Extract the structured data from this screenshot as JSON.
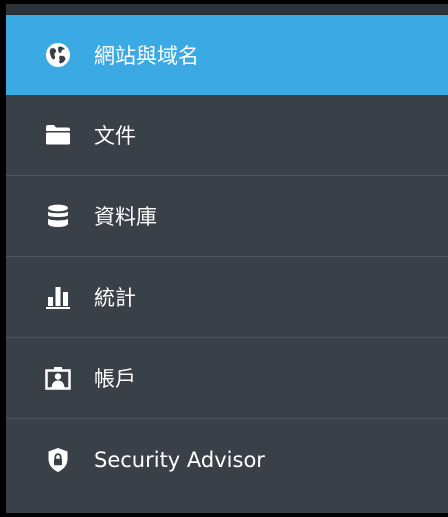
{
  "sidebar": {
    "accent_color": "#3aa9e4",
    "background_color": "#3a4048",
    "items": [
      {
        "label": "網站與域名",
        "icon": "globe-icon",
        "active": true
      },
      {
        "label": "文件",
        "icon": "folder-icon",
        "active": false
      },
      {
        "label": "資料庫",
        "icon": "database-icon",
        "active": false
      },
      {
        "label": "統計",
        "icon": "bar-chart-icon",
        "active": false
      },
      {
        "label": "帳戶",
        "icon": "account-icon",
        "active": false
      },
      {
        "label": "Security Advisor",
        "icon": "shield-lock-icon",
        "active": false
      }
    ]
  }
}
